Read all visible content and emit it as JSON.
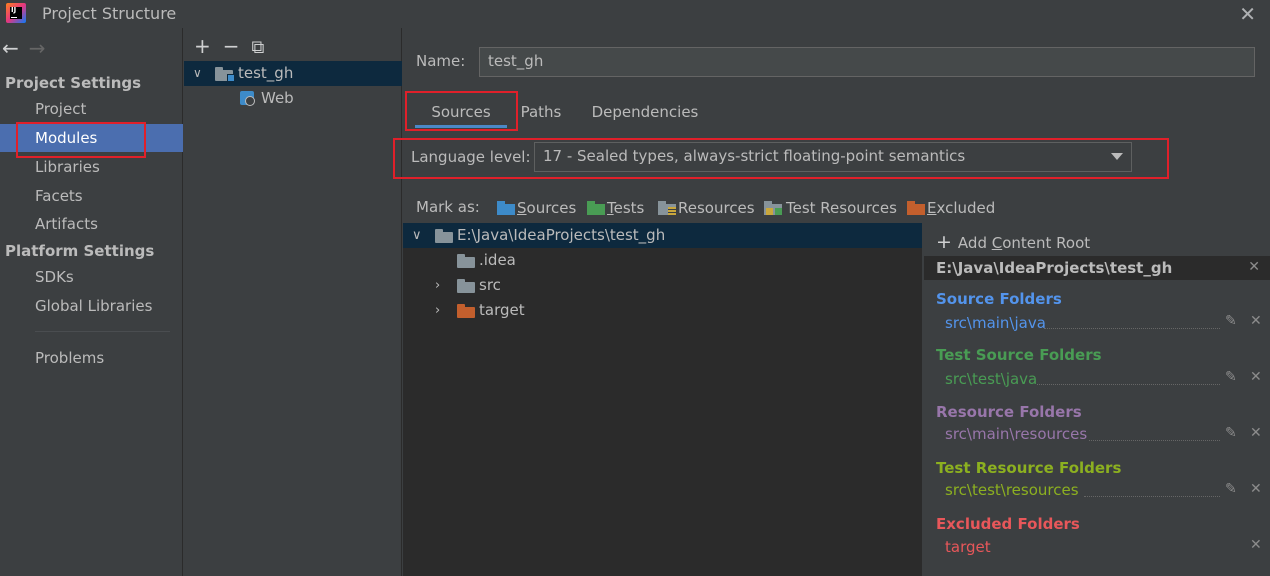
{
  "window": {
    "title": "Project Structure",
    "logo_text": "IJ"
  },
  "nav": {
    "back": "←",
    "forward": "→",
    "project_settings_heading": "Project Settings",
    "platform_settings_heading": "Platform Settings",
    "items": {
      "project": "Project",
      "modules": "Modules",
      "libraries": "Libraries",
      "facets": "Facets",
      "artifacts": "Artifacts",
      "sdks": "SDKs",
      "global_libraries": "Global Libraries",
      "problems": "Problems"
    },
    "selected": "Modules"
  },
  "module_panel": {
    "toolbar": {
      "add": "+",
      "remove": "−",
      "copy": "⧉"
    },
    "module_name": "test_gh",
    "facet_name": "Web"
  },
  "module": {
    "name_label": "Name:",
    "name_value": "test_gh",
    "tabs": {
      "sources": "Sources",
      "paths": "Paths",
      "dependencies": "Dependencies"
    },
    "active_tab": "Sources",
    "language_label": "Language level:",
    "language_value": "17 - Sealed types, always-strict floating-point semantics",
    "mark_as_label": "Mark as:",
    "mark_as": {
      "sources": {
        "first": "S",
        "rest": "ources"
      },
      "tests": {
        "first": "T",
        "rest": "ests"
      },
      "resources": {
        "first": "",
        "rest": "Resources"
      },
      "test_resources": {
        "first": "",
        "rest": "Test Resources"
      },
      "excluded": {
        "first": "E",
        "rest": "xcluded"
      }
    }
  },
  "file_tree": {
    "root": "E:\\Java\\IdeaProjects\\test_gh",
    "children": [
      ".idea",
      "src",
      "target"
    ]
  },
  "roots": {
    "add_content_root": {
      "pre": "Add ",
      "u": "C",
      "post": "ontent Root"
    },
    "root_path": "E:\\Java\\IdeaProjects\\test_gh",
    "groups": {
      "source": {
        "title": "Source Folders",
        "path": "src\\main\\java",
        "color": "#5394ec"
      },
      "test_source": {
        "title": "Test Source Folders",
        "path": "src\\test\\java",
        "color": "#499c54"
      },
      "resource": {
        "title": "Resource Folders",
        "path": "src\\main\\resources",
        "color": "#9876aa"
      },
      "test_resource": {
        "title": "Test Resource Folders",
        "path": "src\\test\\resources",
        "color": "#8cb020"
      },
      "excluded": {
        "title": "Excluded Folders",
        "path": "target",
        "color": "#e8575a"
      }
    }
  },
  "colors": {
    "selection": "#4b6eaf",
    "tree_selection": "#0d293e",
    "highlight_box": "#e0202a",
    "folder_blue": "#87939a",
    "source_folder": "#3d8bc9",
    "test_folder": "#499c54",
    "excluded_folder": "#c35f2d"
  }
}
